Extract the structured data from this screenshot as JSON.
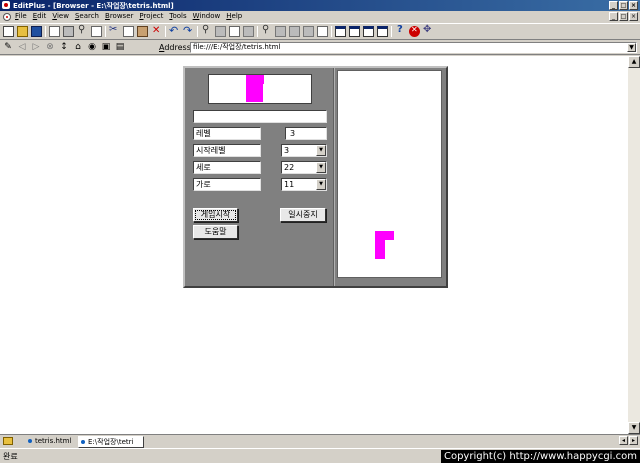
{
  "window": {
    "title": "EditPlus - [Browser - E:\\작업장\\tetris.html]",
    "minimize": "_",
    "maximize": "□",
    "close": "×"
  },
  "menu": {
    "items": [
      "File",
      "Edit",
      "View",
      "Search",
      "Browser",
      "Project",
      "Tools",
      "Window",
      "Help"
    ]
  },
  "address_bar": {
    "label": "Address",
    "url": "file:///E:/작업장/tetris.html"
  },
  "game": {
    "level_label": "레벨",
    "level_value": "3",
    "start_level_label": "시작레벨",
    "start_level_value": "3",
    "height_label": "세로",
    "height_value": "22",
    "width_label": "가로",
    "width_value": "11",
    "start_button": "게임시작",
    "pause_button": "일시중지",
    "help_button": "도움말",
    "piece_color": "#ff00ff"
  },
  "tabs": [
    {
      "label": "tetris.html",
      "active": false
    },
    {
      "label": "E:\\작업장\\tetri",
      "active": true
    }
  ],
  "status": {
    "text": "완료",
    "copyright": "Copyright(c) http://www.happycgi.com"
  }
}
